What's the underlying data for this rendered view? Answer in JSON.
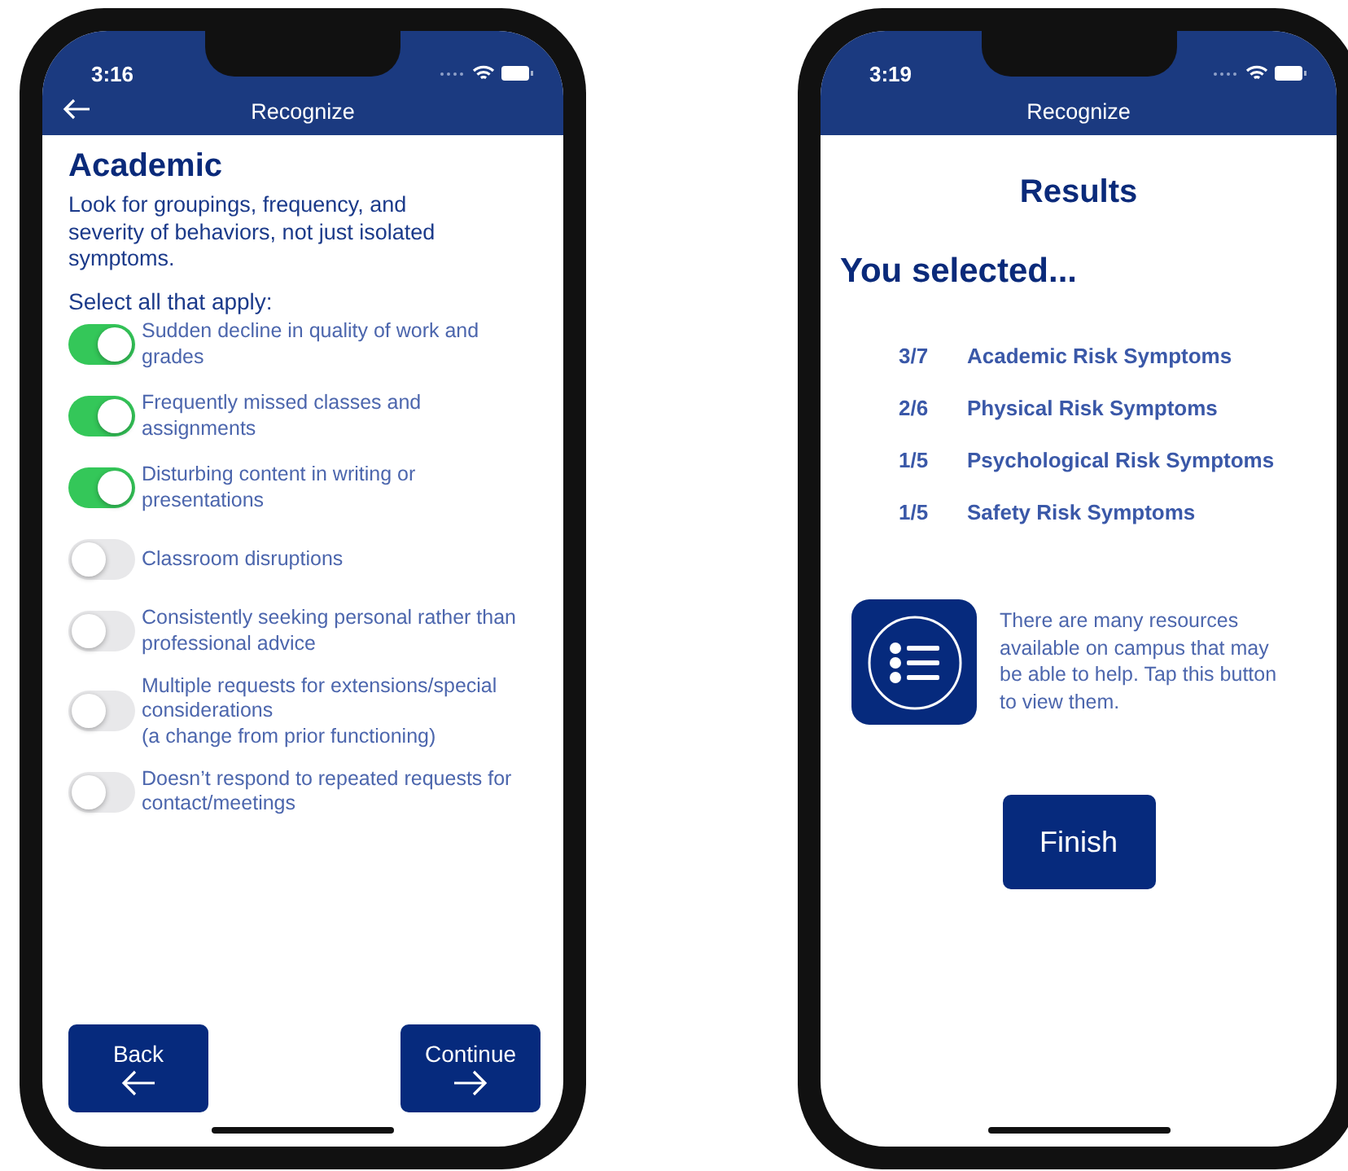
{
  "phones": [
    {
      "kind": "checklist",
      "status_time": "3:16",
      "nav_title": "Recognize",
      "has_back": true,
      "heading": "Academic",
      "intro": "Look for groupings, frequency, and severity of behaviors, not just isolated symptoms.",
      "prompt": "Select all that apply:",
      "options": [
        {
          "label": "Sudden decline in quality of work and grades",
          "on": true
        },
        {
          "label": "Frequently missed classes and assignments",
          "on": true
        },
        {
          "label": "Disturbing content in writing or presentations",
          "on": true
        },
        {
          "label": "Classroom disruptions",
          "on": false
        },
        {
          "label": "Consistently seeking personal rather than professional advice",
          "on": false
        },
        {
          "label": "Multiple requests for extensions/special considerations\n(a change from prior functioning)",
          "on": false
        },
        {
          "label": "Doesn’t respond to repeated requests for contact/meetings",
          "on": false
        }
      ],
      "buttons": [
        {
          "label": "Back",
          "kind": "back"
        },
        {
          "label": "Continue",
          "kind": "forward"
        }
      ]
    },
    {
      "kind": "results",
      "status_time": "3:19",
      "nav_title": "Recognize",
      "has_back": false,
      "title": "Results",
      "subtitle": "You selected...",
      "results": [
        {
          "count": "3/7",
          "label": "Academic Risk Symptoms"
        },
        {
          "count": "2/6",
          "label": "Physical Risk Symptoms"
        },
        {
          "count": "1/5",
          "label": "Psychological Risk Symptoms"
        },
        {
          "count": "1/5",
          "label": "Safety Risk Symptoms"
        }
      ],
      "resources_text": "There are many resources available on campus that may be able to help. Tap this button to view them.",
      "finish": "Finish"
    }
  ]
}
